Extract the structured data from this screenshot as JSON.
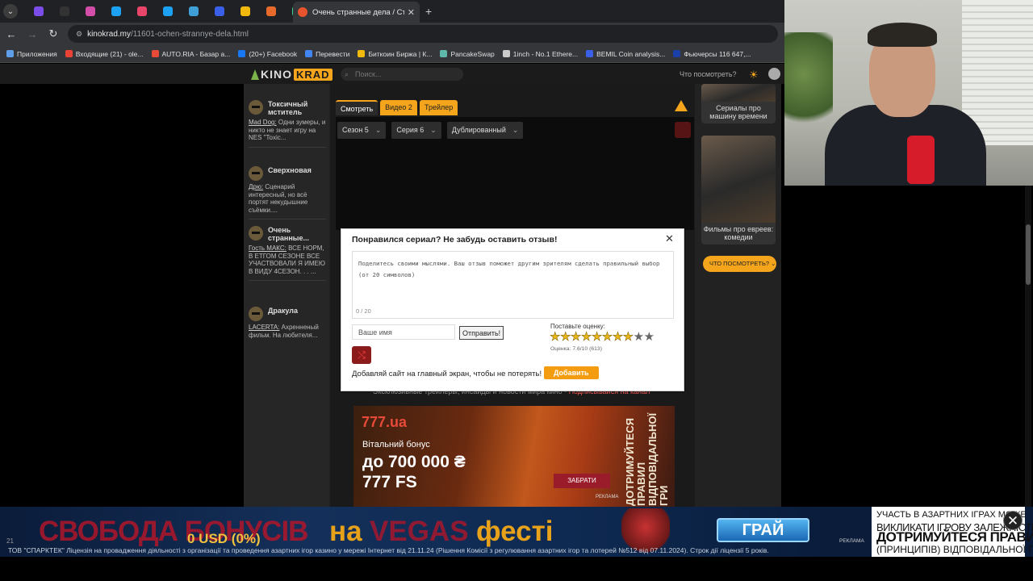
{
  "browser": {
    "active_tab_title": "Очень странные дела / Стран",
    "url_host": "kinokrad.my",
    "url_path": "/11601-ochen-strannye-dela.html",
    "bookmarks": [
      {
        "label": "Приложения",
        "color": "#5f9ee8"
      },
      {
        "label": "Входящие (21) - ole...",
        "color": "#ea4335"
      },
      {
        "label": "AUTO.RIA - Базар а...",
        "color": "#e84a3a"
      },
      {
        "label": "(20+) Facebook",
        "color": "#1877f2"
      },
      {
        "label": "Перевести",
        "color": "#4285f4"
      },
      {
        "label": "Биткоин Биржа | К...",
        "color": "#f0b90b"
      },
      {
        "label": "PancakeSwap",
        "color": "#5fb8a9"
      },
      {
        "label": "1inch - No.1 Ethere...",
        "color": "#cccccc"
      },
      {
        "label": "BEMIL Coin analysis...",
        "color": "#3a5fe8"
      },
      {
        "label": "Фьючерсы 116 647,...",
        "color": "#1a3fa8"
      }
    ]
  },
  "site": {
    "logo_kino": "KINO",
    "logo_krad": "KRAD",
    "search_placeholder": "Поиск...",
    "what_to_watch": "Что посмотреть?"
  },
  "comments": [
    {
      "name": "Токсичный мститель",
      "author": "Mad Dog:",
      "text": "Одни зумеры, и никто не знает игру на NES \"Toxic..."
    },
    {
      "name": "Сверхновая",
      "author": "Дрю:",
      "text": "Сценарий интересный, но всё портят некудышние съёмки...."
    },
    {
      "name": "Очень странные...",
      "author": "Гость МАКС:",
      "text": "ВСЕ НОРМ, В ЕТГОМ СЕЗОНЕ ВСЕ УЧАСТВОВАЛИ Я ИМЕЮ В ВИДУ 4СЕЗОН. . . ..."
    },
    {
      "name": "Дракула",
      "author": "LACERTA:",
      "text": "Ахренненый фильм. На любителя..."
    }
  ],
  "player": {
    "tabs": [
      "Смотреть",
      "Видео 2",
      "Трейлер"
    ],
    "season": "Сезон 5",
    "episode": "Серия 6",
    "voice": "Дублированный"
  },
  "rail": {
    "card1": "Сериалы про машину времени",
    "card2": "Фильмы про евреев: комедии",
    "button": "ЧТО ПОСМОТРЕТЬ?"
  },
  "modal": {
    "title": "Понравился сериал? Не забудь оставить отзыв!",
    "textarea_placeholder": "Поделитесь своими мыслями. Ваш отзыв поможет другим зрителям сделать правильный выбор (от 20 символов)",
    "counter": "0 / 20",
    "name_placeholder": "Ваше имя",
    "send_label": "Отправить!",
    "rate_label": "Поставьте оценку:",
    "stars_total": 10,
    "stars_filled": 8,
    "score_text": "Оценка: 7.6/10 (613)",
    "home_text": "Добавляй сайт на главный экран, чтобы не потерять!",
    "add_label": "Добавить"
  },
  "telegram_line": {
    "text": "Эксклюзивные трейлеры, инсайды и новости мира кино - ",
    "link": "Подписывайся на канал"
  },
  "ad_mid": {
    "brand": "777.ua",
    "line1": "Вітальний бонус",
    "line2": "до 700 000 ₴",
    "line3": "777 FS",
    "cta": "ЗАБРАТИ",
    "reklama": "РЕКЛАМА",
    "vertical": "ДОТРИМУЙТЕСЯ ПРАВИЛ ВІДПОВІДАЛЬНОЇ ГРИ"
  },
  "banner": {
    "big1": "СВОБОДА БОНУСІВ",
    "big2": "на",
    "big3": "VEGAS",
    "big4": "фесті",
    "usd": "0 USD (0%)",
    "cta": "ГРАЙ",
    "reklama": "РЕКЛАМА",
    "right1": "УЧАСТЬ В АЗАРТНИХ ІГРАХ МОЖЕ",
    "right2": "ВИКЛИКАТИ ІГРОВУ ЗАЛЕЖНІСТЬ",
    "right3": "ДОТРИМУЙТЕСЯ ПРАВИЛ",
    "right4": "(ПРИНЦИПІВ) ВІДПОВІДАЛЬНОЇ ГРИ.",
    "license": "ТОВ \"СПАРКТЕК\" Ліцензія на провадження діяльності з організації та проведення азартних ігор казино у мережі Інтернет від 21.11.24 (Рішення Комісії з регулювання азартних ігор та лотерей №512 від 07.11.2024). Строк дії ліцензії 5 років."
  }
}
